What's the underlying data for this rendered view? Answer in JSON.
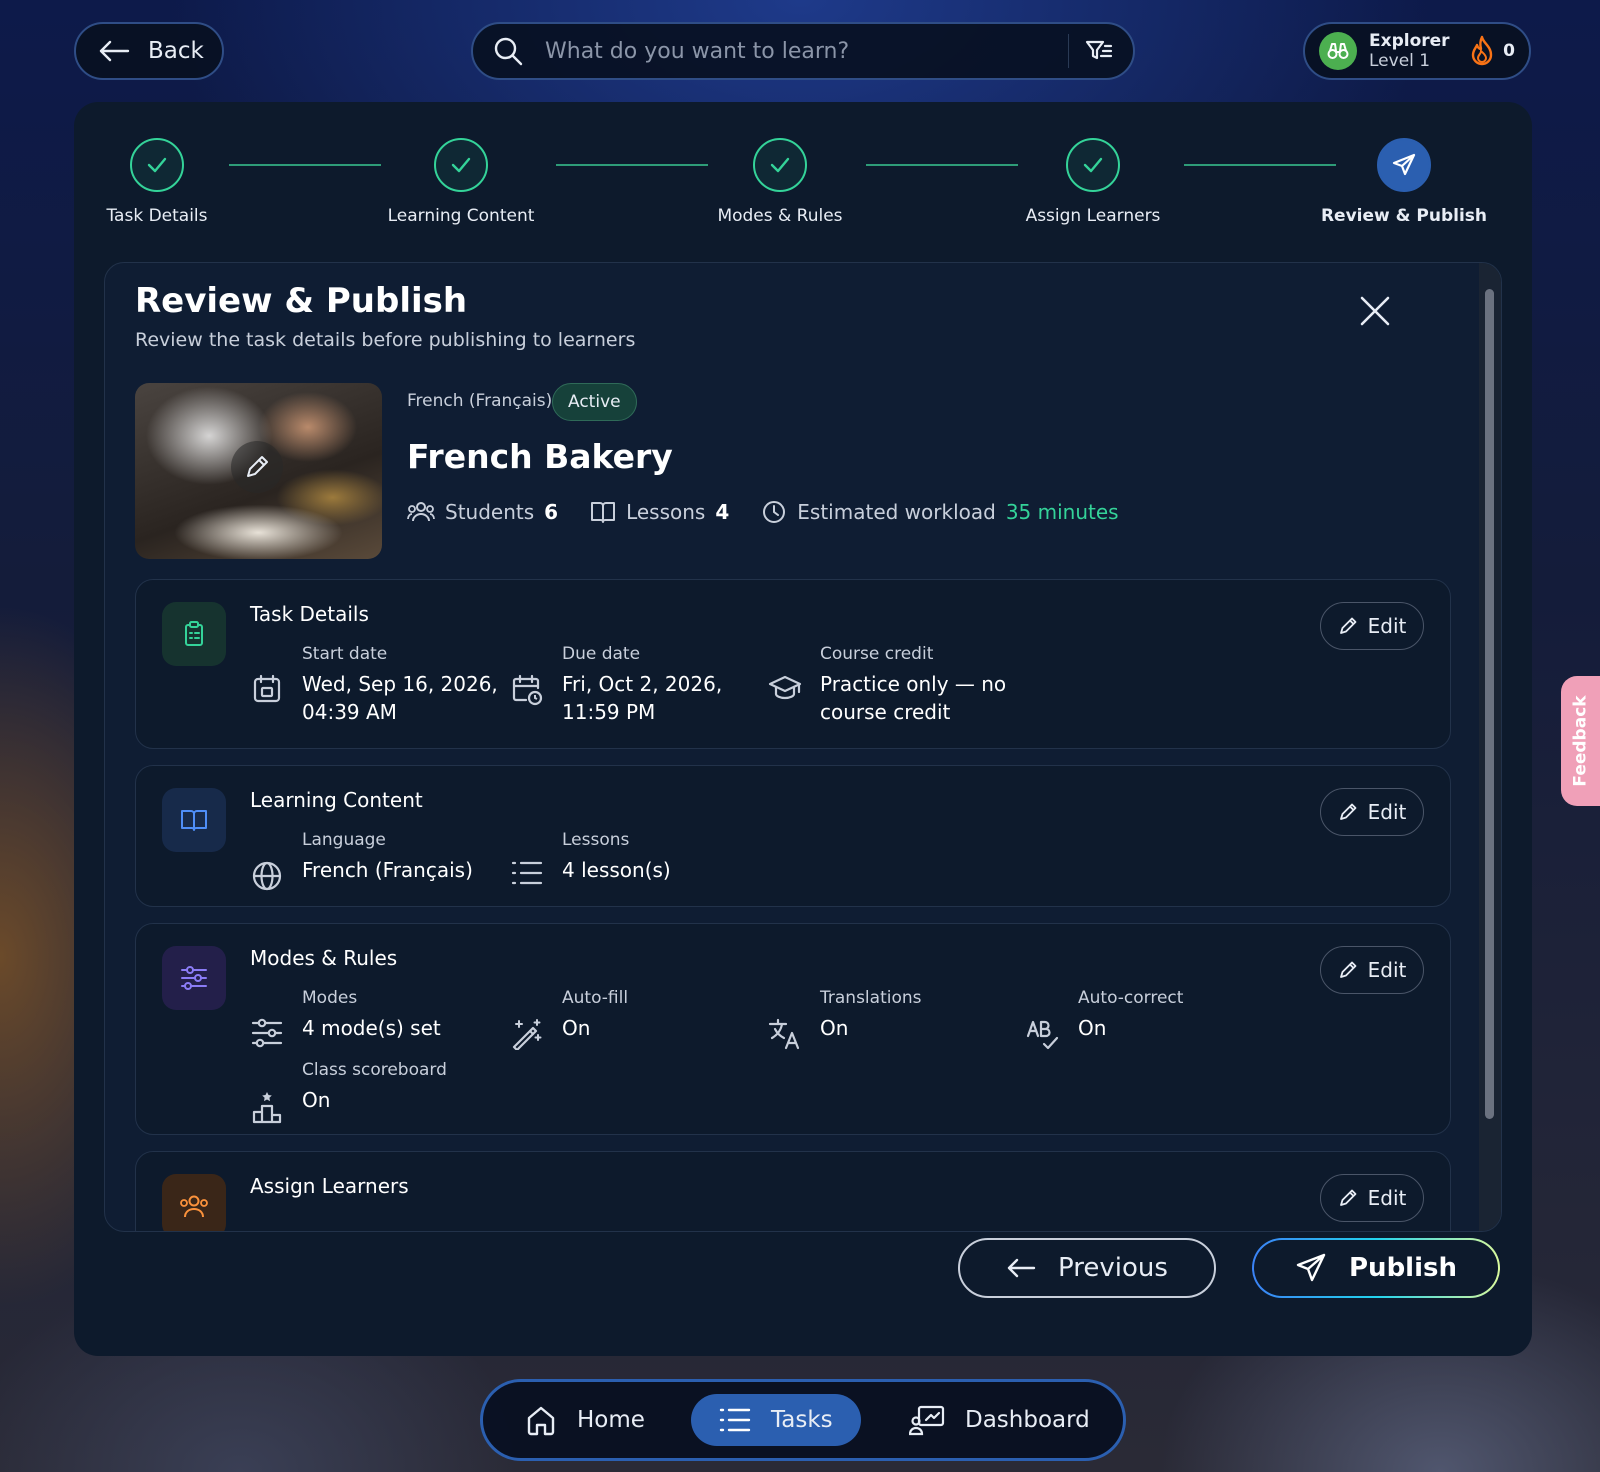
{
  "topbar": {
    "back_label": "Back",
    "search_placeholder": "What do you want to learn?",
    "profile_name": "Explorer",
    "profile_level": "Level 1",
    "streak_count": "0"
  },
  "stepper": {
    "steps": [
      {
        "label": "Task Details",
        "state": "done"
      },
      {
        "label": "Learning Content",
        "state": "done"
      },
      {
        "label": "Modes & Rules",
        "state": "done"
      },
      {
        "label": "Assign Learners",
        "state": "done"
      },
      {
        "label": "Review & Publish",
        "state": "active"
      }
    ]
  },
  "review": {
    "title": "Review & Publish",
    "subtitle": "Review the task details before publishing to learners",
    "task": {
      "language_tag": "French (Français)",
      "status": "Active",
      "title": "French Bakery",
      "students_label": "Students",
      "students_value": "6",
      "lessons_label": "Lessons",
      "lessons_value": "4",
      "workload_label": "Estimated workload",
      "workload_value": "35 minutes"
    },
    "sections": {
      "task_details": {
        "title": "Task Details",
        "edit_label": "Edit",
        "start_label": "Start date",
        "start_line1": "Wed, Sep 16, 2026,",
        "start_line2": "04:39 AM",
        "due_label": "Due date",
        "due_line1": "Fri, Oct 2, 2026,",
        "due_line2": "11:59 PM",
        "credit_label": "Course credit",
        "credit_line1": "Practice only — no",
        "credit_line2": "course credit"
      },
      "learning_content": {
        "title": "Learning Content",
        "edit_label": "Edit",
        "language_label": "Language",
        "language_value": "French (Français)",
        "lessons_label": "Lessons",
        "lessons_value": "4 lesson(s)"
      },
      "modes_rules": {
        "title": "Modes & Rules",
        "edit_label": "Edit",
        "modes_label": "Modes",
        "modes_value": "4 mode(s) set",
        "autofill_label": "Auto-fill",
        "autofill_value": "On",
        "translations_label": "Translations",
        "translations_value": "On",
        "autocorrect_label": "Auto-correct",
        "autocorrect_value": "On",
        "scoreboard_label": "Class scoreboard",
        "scoreboard_value": "On"
      },
      "assign_learners": {
        "title": "Assign Learners",
        "edit_label": "Edit"
      }
    }
  },
  "footer": {
    "previous_label": "Previous",
    "publish_label": "Publish"
  },
  "bottom_nav": {
    "items": [
      {
        "label": "Home"
      },
      {
        "label": "Tasks",
        "active": true
      },
      {
        "label": "Dashboard"
      }
    ]
  },
  "feedback_label": "Feedback",
  "colors": {
    "accent_blue": "#2b5fb0",
    "success_green": "#34d399",
    "panel_bg": "#0d1a2c"
  }
}
